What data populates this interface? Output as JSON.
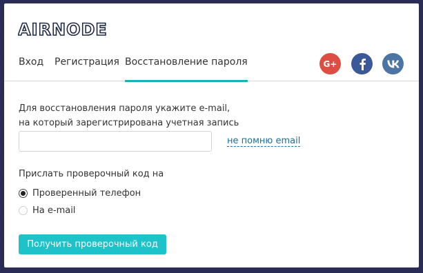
{
  "brand": {
    "logo_text": "AIRNODE",
    "accent": "#16b4b9"
  },
  "tabs": [
    {
      "label": "Вход",
      "active": false
    },
    {
      "label": "Регистрация",
      "active": false
    },
    {
      "label": "Восстановление пароля",
      "active": true
    }
  ],
  "social": [
    {
      "icon": "google-plus-icon",
      "glyph": "G+",
      "color": "#dc4e41"
    },
    {
      "icon": "facebook-icon",
      "glyph": "f",
      "color": "#3b5998"
    },
    {
      "icon": "vk-icon",
      "glyph": "vk",
      "color": "#4c75a3"
    }
  ],
  "form": {
    "intro_line1": "Для восстановления пароля укажите e-mail,",
    "intro_line2": "на который зарегистрирована учетная запись",
    "email_value": "",
    "email_placeholder": "",
    "forgot_link": "не помню email",
    "send_label": "Прислать проверочный код на",
    "options": [
      {
        "label": "Проверенный телефон",
        "selected": true
      },
      {
        "label": "На e-mail",
        "selected": false
      }
    ],
    "submit_label": "Получить проверочный код"
  }
}
